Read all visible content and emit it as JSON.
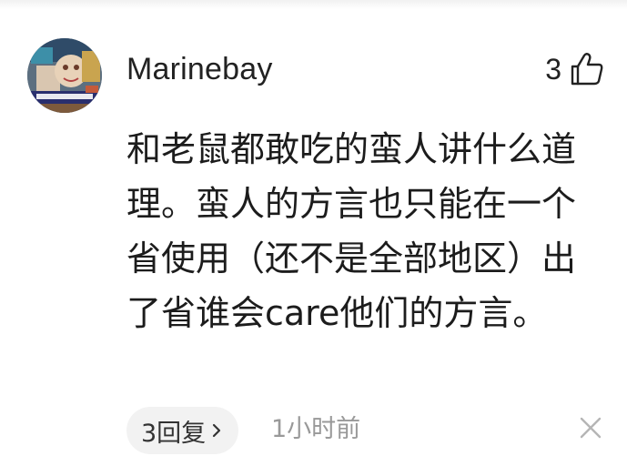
{
  "comment": {
    "username": "Marinebay",
    "like_count": "3",
    "body": "和老鼠都敢吃的蛮人讲什么道理。蛮人的方言也只能在一个省使用（还不是全部地区）出了省谁会care他们的方言。",
    "reply_label": "3回复",
    "timestamp": "1小时前"
  },
  "icons": {
    "avatar": "user-avatar",
    "like": "thumbs-up-icon",
    "reply_arrow": "chevron-right-icon",
    "dismiss": "close-icon"
  },
  "colors": {
    "text_primary": "#1c1c1c",
    "text_secondary": "#999999",
    "chip_background": "#f2f2f2"
  }
}
